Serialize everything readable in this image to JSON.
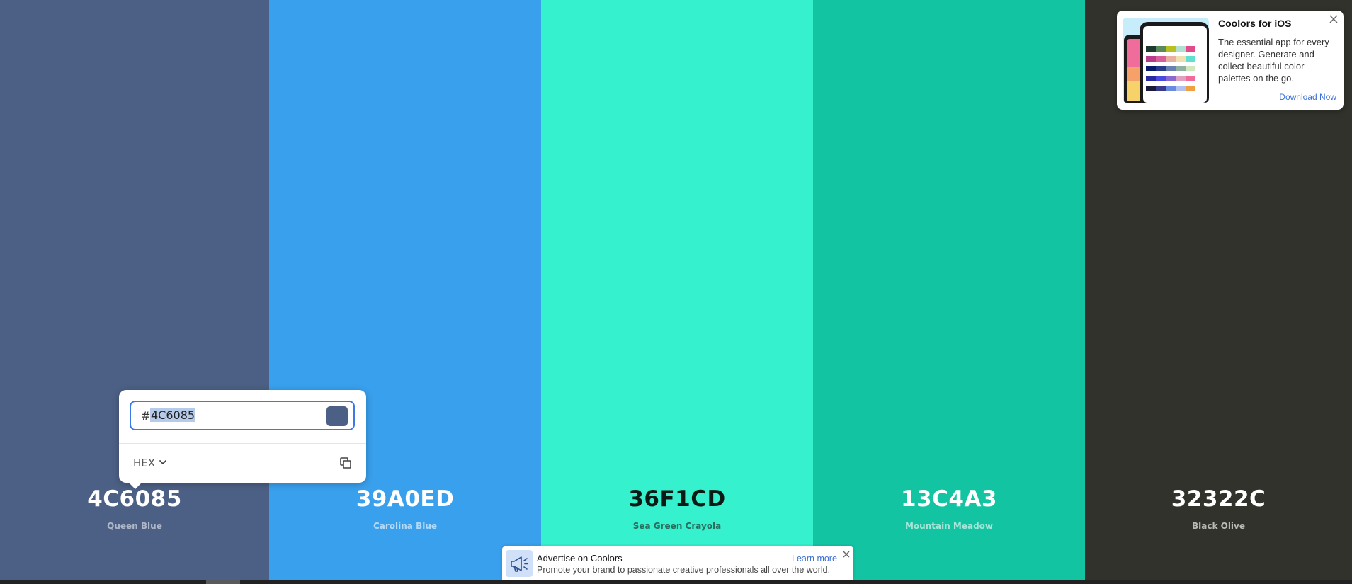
{
  "palette": {
    "colors": [
      {
        "hex": "4C6085",
        "name": "Queen Blue",
        "bg": "#4c6085",
        "text": "#ffffff",
        "sub": "#aeb7c7"
      },
      {
        "hex": "39A0ED",
        "name": "Carolina Blue",
        "bg": "#39a0ed",
        "text": "#ffffff",
        "sub": "#b5daf7"
      },
      {
        "hex": "36F1CD",
        "name": "Sea Green Crayola",
        "bg": "#36f1cd",
        "text": "#0c1a16",
        "sub": "#2a6c5e"
      },
      {
        "hex": "13C4A3",
        "name": "Mountain Meadow",
        "bg": "#13c4a3",
        "text": "#ffffff",
        "sub": "#a6e5d8"
      },
      {
        "hex": "32322C",
        "name": "Black Olive",
        "bg": "#32322c",
        "text": "#ffffff",
        "sub": "#b9b9b5"
      }
    ]
  },
  "picker": {
    "hash": "#",
    "value": "4C6085",
    "mode": "HEX",
    "swatch_color": "#4c6085"
  },
  "ios_ad": {
    "title": "Coolors for iOS",
    "description": "The essential app for every designer. Generate and collect beautiful color palettes on the go.",
    "cta": "Download Now"
  },
  "advert": {
    "title": "Advertise on Coolors",
    "description": "Promote your brand to passionate creative professionals all over the world.",
    "cta": "Learn more"
  },
  "icons": {
    "chevron": "chevron-down-icon",
    "copy": "copy-icon",
    "close": "close-icon",
    "megaphone": "megaphone-icon"
  }
}
